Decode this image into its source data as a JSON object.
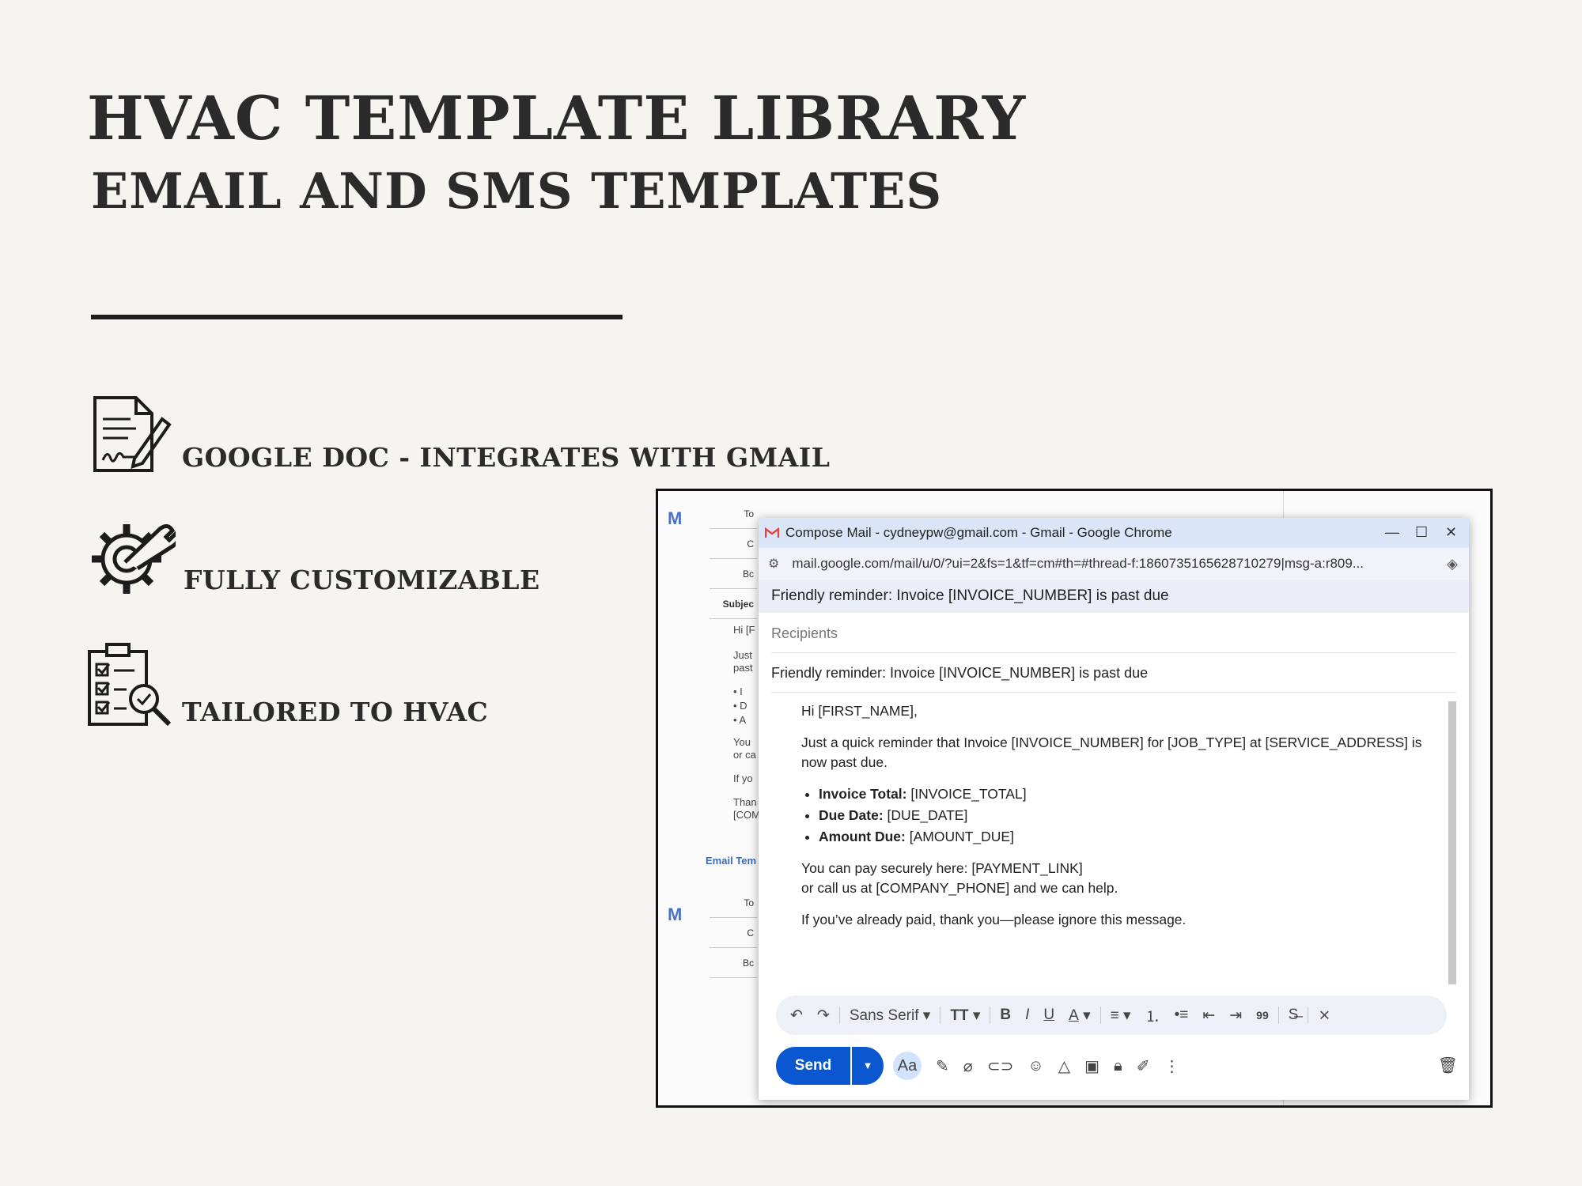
{
  "heading": {
    "title": "HVAC TEMPLATE LIBRARY",
    "subtitle": "EMAIL AND SMS TEMPLATES"
  },
  "features": [
    {
      "label": "GOOGLE DOC - INTEGRATES WITH GMAIL",
      "icon": "signed-document-icon"
    },
    {
      "label": "FULLY CUSTOMIZABLE",
      "icon": "gear-wrench-icon"
    },
    {
      "label": "TAILORED TO HVAC",
      "icon": "checklist-magnifier-icon"
    }
  ],
  "background_doc": {
    "rows": [
      "To",
      "C",
      "Bc",
      "Subjec"
    ],
    "lines": [
      "Hi [F",
      "Just",
      "past",
      "•  I",
      "•  D",
      "•  A",
      "You",
      "or ca",
      "If yo",
      "Than",
      "[COM"
    ],
    "section_link": "Email Tem",
    "rows2": [
      "To",
      "C",
      "Bc"
    ]
  },
  "compose": {
    "window_title": "Compose Mail - cydneypw@gmail.com - Gmail - Google Chrome",
    "url": "mail.google.com/mail/u/0/?ui=2&fs=1&tf=cm#th=#thread-f:1860735165628710279|msg-a:r809...",
    "header_subject": "Friendly reminder: Invoice [INVOICE_NUMBER] is past due",
    "recipients_placeholder": "Recipients",
    "subject": "Friendly reminder: Invoice [INVOICE_NUMBER] is past due",
    "body": {
      "greeting": "Hi [FIRST_NAME],",
      "intro": "Just a quick reminder that Invoice [INVOICE_NUMBER] for [JOB_TYPE] at [SERVICE_ADDRESS] is now past due.",
      "items": [
        {
          "label": "Invoice Total:",
          "value": " [INVOICE_TOTAL]"
        },
        {
          "label": "Due Date:",
          "value": " [DUE_DATE]"
        },
        {
          "label": "Amount Due:",
          "value": " [AMOUNT_DUE]"
        }
      ],
      "pay_line": "You can pay securely here: [PAYMENT_LINK]",
      "call_line": "or call us at [COMPANY_PHONE] and we can help.",
      "closing": "If you’ve already paid, thank you—please ignore this message."
    },
    "toolbar": {
      "font": "Sans Serif",
      "undo": "↶",
      "redo": "↷",
      "size": "TT",
      "bold": "B",
      "italic": "I",
      "underline": "U",
      "color": "A",
      "align": "≡",
      "numbered": "⒈",
      "bulleted": "•≡",
      "indent_less": "⇤",
      "indent_more": "⇥",
      "quote": "99",
      "strike": "S̶",
      "clear": "⨯"
    },
    "send_label": "Send",
    "format_label": "Aa"
  }
}
